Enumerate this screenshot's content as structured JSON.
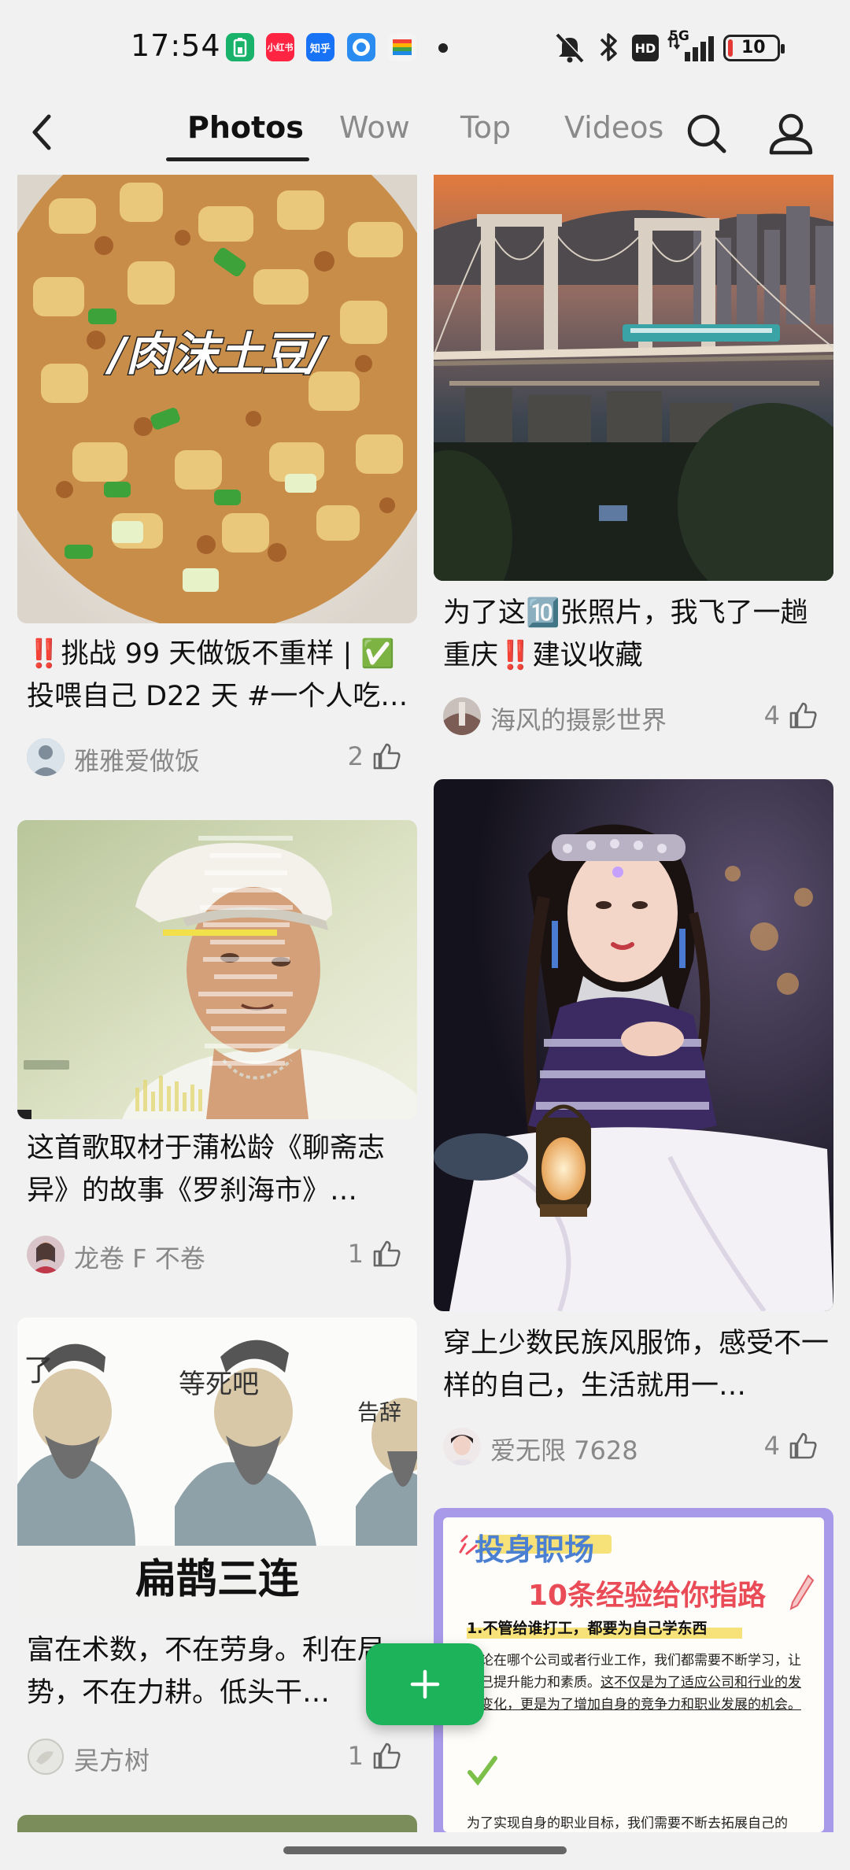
{
  "status_bar": {
    "time": "17:54",
    "apps": [
      {
        "icon": "battery-saver-app-icon",
        "color": "#18b26b",
        "label": ""
      },
      {
        "icon": "xiaohongshu-app-icon",
        "color": "#ff2442",
        "label": "小红书"
      },
      {
        "icon": "zhihu-app-icon",
        "color": "#1772f6",
        "label": "知乎"
      },
      {
        "icon": "browser-app-icon",
        "color": "#2a8cf0",
        "label": ""
      },
      {
        "icon": "wallet-app-icon",
        "color": "#f5a623",
        "label": ""
      }
    ],
    "hd_label": "HD",
    "network": "5G",
    "battery": "10",
    "battery_level": 0.1
  },
  "nav": {
    "tabs": [
      "Photos",
      "Wow",
      "Top",
      "Videos"
    ],
    "active_tab": "Photos"
  },
  "feed": {
    "left": [
      {
        "image_caption": "/肉沫土豆/",
        "title": "‼️挑战 99 天做饭不重样 | ✅投喂自己 D22 天 #一个人吃…",
        "author": "雅雅爱做饭",
        "likes": "2"
      },
      {
        "title": "这首歌取材于蒲松龄《聊斋志异》的故事《罗刹海市》…",
        "author": "龙卷 F 不卷",
        "likes": "1"
      },
      {
        "image_texts": [
          "了",
          "等死吧",
          "告辞"
        ],
        "image_caption": "扁鹊三连",
        "title": "富在术数，不在劳身。利在局势，不在力耕。低头干…",
        "author": "吴方树",
        "likes": "1"
      }
    ],
    "right": [
      {
        "title": "为了这🔟张照片，我飞了一趟重庆‼️建议收藏",
        "author": "海风的摄影世界",
        "likes": "4"
      },
      {
        "title": "穿上少数民族风服饰，感受不一样的自己，生活就用一…",
        "author": "爱无限 7628",
        "likes": "4"
      },
      {
        "poster": {
          "heading1": "投身职场",
          "heading2": "10条经验给你指路",
          "point": "1.不管给谁打工，都要为自己学东西",
          "body": "无论在哪个公司或者行业工作，我们都需要不断学习，让自己提升能力和素质。",
          "underlined": "这不仅是为了适应公司和行业的发展变化，更是为了增加自身的竞争力和职业发展的机会。",
          "footer": "为了实现自身的职业目标，我们需要不断去拓展自己的"
        }
      }
    ]
  },
  "fab": {
    "icon": "plus-icon"
  }
}
